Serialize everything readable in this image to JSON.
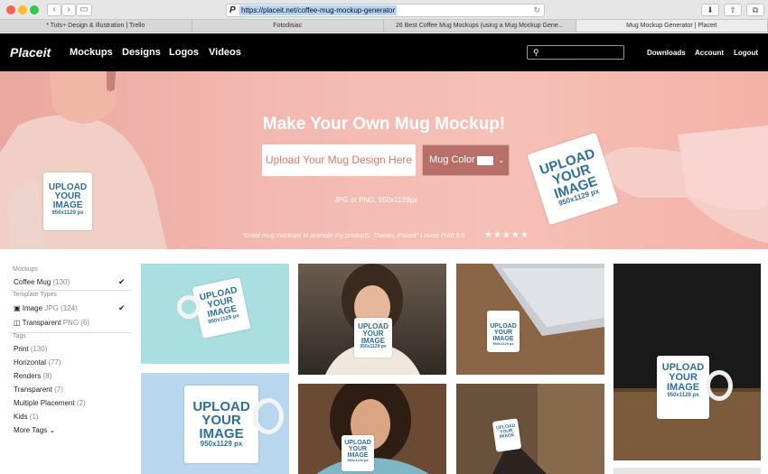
{
  "browser": {
    "url": "https://placeit.net/coffee-mug-mockup-generator",
    "url_prefix_icon": "P",
    "tabs": [
      {
        "label": "* Tuts+ Design & Illustration | Trello",
        "active": false
      },
      {
        "label": "Fotodisiac",
        "active": false
      },
      {
        "label": "26 Best Coffee Mug Mockups (using a Mug Mockup Gene...",
        "active": false
      },
      {
        "label": "Mug Mockup Generator | Placeit",
        "active": true
      }
    ]
  },
  "nav": {
    "logo": "Placeit",
    "links": [
      "Mockups",
      "Designs",
      "Logos",
      "Videos"
    ],
    "right_links": [
      "Downloads",
      "Account",
      "Logout"
    ]
  },
  "hero": {
    "title": "Make Your Own Mug Mockup!",
    "upload_label": "Upload Your Mug Design Here",
    "mug_color_label": "Mug Color",
    "hint": "JPG or PNG, 950x1129px",
    "quote": "\"Great mug mockups to promote my products. Thanks, Placeit\" Louise Pratt 5.0",
    "stars": "★★★★★"
  },
  "mug_text": {
    "line1": "UPLOAD",
    "line2": "YOUR",
    "line3": "IMAGE",
    "line4": "950x1129 px"
  },
  "sidebar": {
    "mockups_heading": "Mockups",
    "mockups": [
      {
        "label": "Coffee Mug",
        "count": "(130)",
        "checked": true
      }
    ],
    "template_types_heading": "Template Types",
    "template_types": [
      {
        "label": "Image",
        "format": "JPG",
        "count": "(124)",
        "checked": true,
        "icon": "camera-icon"
      },
      {
        "label": "Transparent",
        "format": "PNG",
        "count": "(6)",
        "checked": false,
        "icon": "layers-icon"
      }
    ],
    "tags_heading": "Tags",
    "tags": [
      {
        "label": "Print",
        "count": "(130)"
      },
      {
        "label": "Horizontal",
        "count": "(77)"
      },
      {
        "label": "Renders",
        "count": "(8)"
      },
      {
        "label": "Transparent",
        "count": "(7)"
      },
      {
        "label": "Multiple Placement",
        "count": "(2)"
      },
      {
        "label": "Kids",
        "count": "(1)"
      }
    ],
    "more_tags": "More Tags"
  },
  "colors": {
    "nav_bg": "#000000",
    "hero_pink": "#f3b9b0",
    "accent": "#e0786a",
    "mug_text": "#2f6d9e"
  }
}
